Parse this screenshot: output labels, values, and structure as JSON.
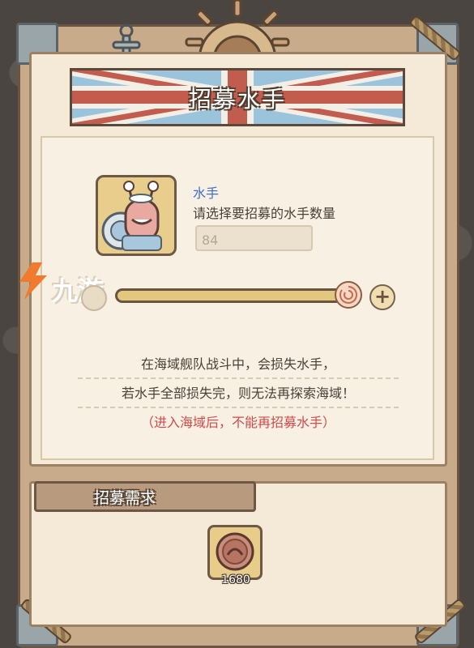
{
  "dialog": {
    "title": "招募水手"
  },
  "unit": {
    "name": "水手",
    "prompt": "请选择要招募的水手数量",
    "quantity_value": "84"
  },
  "slider": {
    "level_fraction": 1.0,
    "plus_label": "+"
  },
  "info": {
    "line1": "在海域舰队战斗中，会损失水手，",
    "line2": "若水手全部损失完，则无法再探索海域！",
    "warning": "（进入海域后，不能再招募水手）"
  },
  "requirements": {
    "title": "招募需求",
    "cost": "1680",
    "cost_icon": "coin-icon"
  },
  "watermark": {
    "text": "九游"
  },
  "colors": {
    "banner_red": "#c15c4f",
    "banner_blue": "#9cc3dc",
    "unit_name": "#3d6fc9",
    "warning_red": "#d24b4b",
    "panel_bg": "#f4ead7"
  }
}
